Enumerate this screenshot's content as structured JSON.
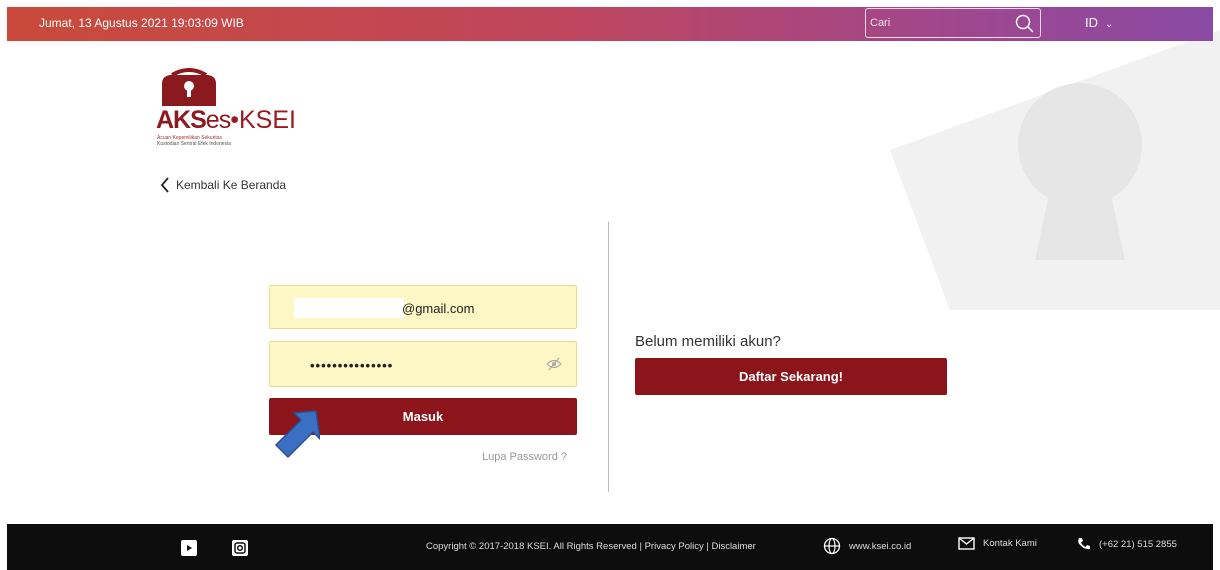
{
  "topbar": {
    "datetime": "Jumat, 13 Agustus 2021 19:03:09 WIB",
    "search_placeholder": "Cari",
    "language": "ID",
    "language_chevron": "⌄"
  },
  "logo": {
    "brand_part1": "AKS",
    "brand_part2": "es",
    "brand_dot": "•",
    "brand_part3": "KSEI",
    "tagline1": "Acuan Kepemilikan Sekuritas",
    "tagline2": "Kustodian Sentral Efek Indonesia"
  },
  "back_link": {
    "label": "Kembali Ke Beranda"
  },
  "login": {
    "email_value": "@gmail.com",
    "password_value": "•••••••••••••••",
    "submit_label": "Masuk",
    "forgot_label": "Lupa Password ?"
  },
  "register": {
    "prompt": "Belum memiliki akun?",
    "button_label": "Daftar Sekarang!"
  },
  "footer": {
    "copyright": "Copyright © 2017-2018 KSEI. All Rights Reserved |",
    "privacy": "Privacy Policy",
    "sep": "|",
    "disclaimer": "Disclaimer",
    "website": "www.ksei.co.id",
    "contact": "Kontak Kami",
    "phone": "(+62 21) 515 2855"
  },
  "colors": {
    "brand": "#8b151a",
    "topbar_start": "#c94a3a",
    "topbar_end": "#8a4aa5",
    "field_bg": "#fdf6c5"
  },
  "icons": [
    "search-icon",
    "chevron-down-icon",
    "chevron-left-icon",
    "eye-slash-icon",
    "youtube-icon",
    "instagram-icon",
    "globe-icon",
    "mail-icon",
    "phone-icon",
    "lock-watermark-icon",
    "pointer-arrow-icon"
  ]
}
